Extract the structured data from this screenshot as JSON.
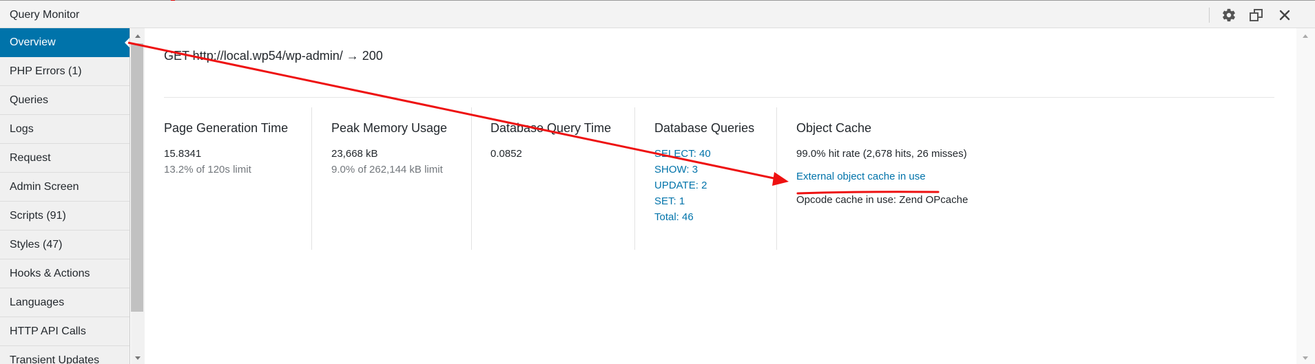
{
  "window": {
    "title": "Query Monitor"
  },
  "toolbar": {
    "settings_icon": "gear-icon",
    "pin_icon": "pin-window-icon",
    "close_icon": "close-icon"
  },
  "sidebar": {
    "items": [
      {
        "label": "Overview",
        "active": true
      },
      {
        "label": "PHP Errors (1)"
      },
      {
        "label": "Queries"
      },
      {
        "label": "Logs"
      },
      {
        "label": "Request"
      },
      {
        "label": "Admin Screen"
      },
      {
        "label": "Scripts (91)"
      },
      {
        "label": "Styles (47)"
      },
      {
        "label": "Hooks & Actions"
      },
      {
        "label": "Languages"
      },
      {
        "label": "HTTP API Calls"
      },
      {
        "label": "Transient Updates"
      }
    ]
  },
  "main": {
    "request_line": "GET http://local.wp54/wp-admin/ → 200",
    "page_generation": {
      "heading": "Page Generation Time",
      "value": "15.8341",
      "sub": "13.2% of 120s limit"
    },
    "peak_memory": {
      "heading": "Peak Memory Usage",
      "value": "23,668 kB",
      "sub": "9.0% of 262,144 kB limit"
    },
    "db_query_time": {
      "heading": "Database Query Time",
      "value": "0.0852"
    },
    "db_queries": {
      "heading": "Database Queries",
      "links": [
        "SELECT: 40",
        "SHOW: 3",
        "UPDATE: 2",
        "SET: 1",
        "Total: 46"
      ]
    },
    "object_cache": {
      "heading": "Object Cache",
      "hit_rate": "99.0% hit rate (2,678 hits, 26 misses)",
      "external_link": "External object cache in use",
      "opcode": "Opcode cache in use: Zend OPcache"
    }
  },
  "colors": {
    "accent": "#0073aa",
    "annotation": "#ee1111"
  }
}
